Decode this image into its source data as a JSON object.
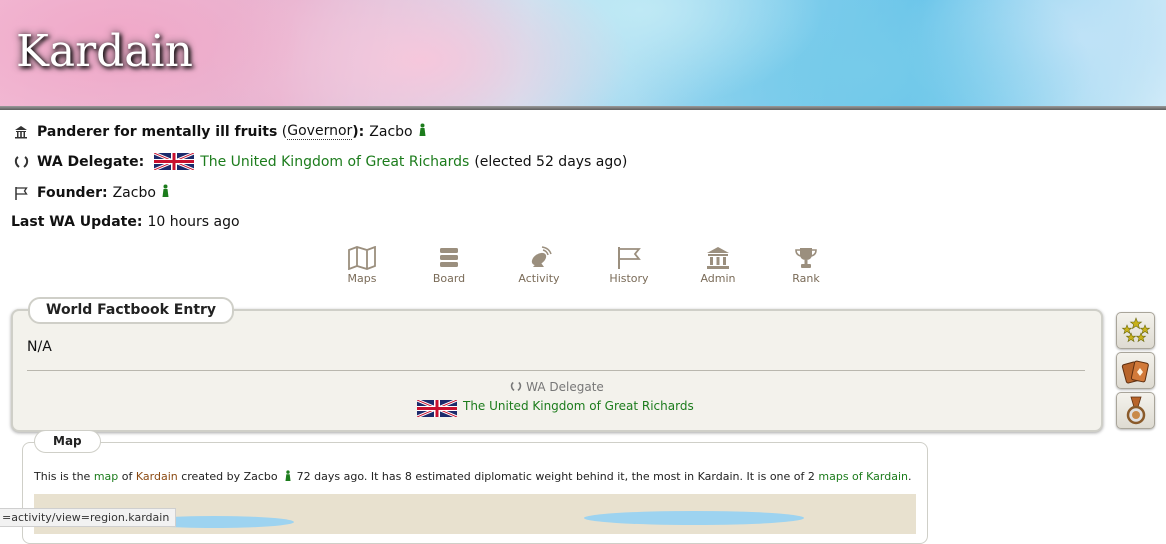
{
  "region": {
    "name": "Kardain"
  },
  "governor": {
    "title": "Panderer for mentally ill fruits",
    "open_paren": " (",
    "role": "Governor",
    "close_paren": "):",
    "name": "Zacbo"
  },
  "wa_delegate": {
    "label": "WA Delegate:",
    "nation": "The United Kingdom of Great Richards",
    "elected": "(elected 52 days ago)"
  },
  "founder": {
    "label": "Founder:",
    "name": "Zacbo"
  },
  "last_update": {
    "label": "Last WA Update:",
    "value": "10 hours ago"
  },
  "nav": [
    {
      "label": "Maps",
      "icon": "map-icon"
    },
    {
      "label": "Board",
      "icon": "board-icon"
    },
    {
      "label": "Activity",
      "icon": "activity-icon"
    },
    {
      "label": "History",
      "icon": "history-icon"
    },
    {
      "label": "Admin",
      "icon": "admin-icon"
    },
    {
      "label": "Rank",
      "icon": "rank-icon"
    }
  ],
  "factbook": {
    "title": "World Factbook Entry",
    "text": "N/A",
    "delegate_label": "WA Delegate",
    "delegate_nation": "The United Kingdom of Great Richards"
  },
  "side_badges": [
    "stars-badge-icon",
    "cards-badge-icon",
    "medal-badge-icon"
  ],
  "map_section": {
    "title": "Map",
    "t1": "This is the ",
    "link_map": "map",
    "t2": " of ",
    "link_region": "Kardain",
    "t3": " created by ",
    "creator": "Zacbo",
    "t4": " 72 days ago. It has 8 estimated diplomatic weight behind it, the most in Kardain. It is one of 2 ",
    "link_maps": "maps of Kardain",
    "t5": "."
  },
  "status_bar": {
    "url": "=activity/view=region.kardain"
  },
  "colors": {
    "link_green": "#1c7c1c",
    "nav_brown": "#7a6b58",
    "panel_bg": "#f3f2ec"
  }
}
